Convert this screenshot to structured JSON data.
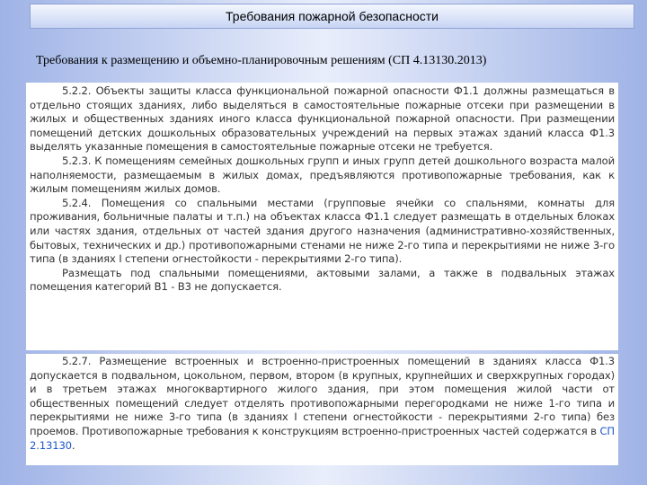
{
  "header": {
    "title": "Требования пожарной безопасности"
  },
  "subtitle": "Требования к размещению и объемно-планировочным решениям (СП 4.13130.2013)",
  "block1": {
    "paragraphs": [
      "5.2.2. Объекты защиты класса функциональной пожарной опасности Ф1.1 должны размещаться в отдельно стоящих зданиях, либо выделяться в самостоятельные пожарные отсеки при размещении в жилых и общественных зданиях иного класса функциональной пожарной опасности. При размещении помещений детских дошкольных образовательных учреждений на первых этажах зданий класса Ф1.3 выделять указанные помещения в самостоятельные пожарные отсеки не требуется.",
      "5.2.3. К помещениям семейных дошкольных групп и иных групп детей дошкольного возраста малой наполняемости, размещаемым в жилых домах, предъявляются противопожарные требования, как к жилым помещениям жилых домов.",
      "5.2.4. Помещения со спальными местами (групповые ячейки со спальнями, комнаты для проживания, больничные палаты и т.п.) на объектах класса Ф1.1 следует размещать в отдельных блоках или частях здания, отдельных от частей здания другого назначения (административно-хозяйственных, бытовых, технических и др.) противопожарными стенами не ниже 2-го типа и перекрытиями не ниже 3-го типа (в зданиях I степени огнестойкости - перекрытиями 2-го типа).",
      "Размещать под спальными помещениями, актовыми залами, а также в подвальных этажах помещения категорий В1 - В3 не допускается."
    ]
  },
  "block2": {
    "paragraph": "5.2.7. Размещение встроенных и встроенно-пристроенных помещений в зданиях класса Ф1.3 допускается в подвальном, цокольном, первом, втором (в крупных, крупнейших и сверхкрупных городах) и в третьем этажах многоквартирного жилого здания, при этом помещения жилой части от общественных помещений следует отделять противопожарными перегородками не ниже 1-го типа и перекрытиями не ниже 3-го типа (в зданиях I степени огнестойкости - перекрытиями 2-го типа) без проемов. Противопожарные требования к конструкциям встроенно-пристроенных частей содержатся в",
    "link": "СП 2.13130",
    "end": "."
  }
}
